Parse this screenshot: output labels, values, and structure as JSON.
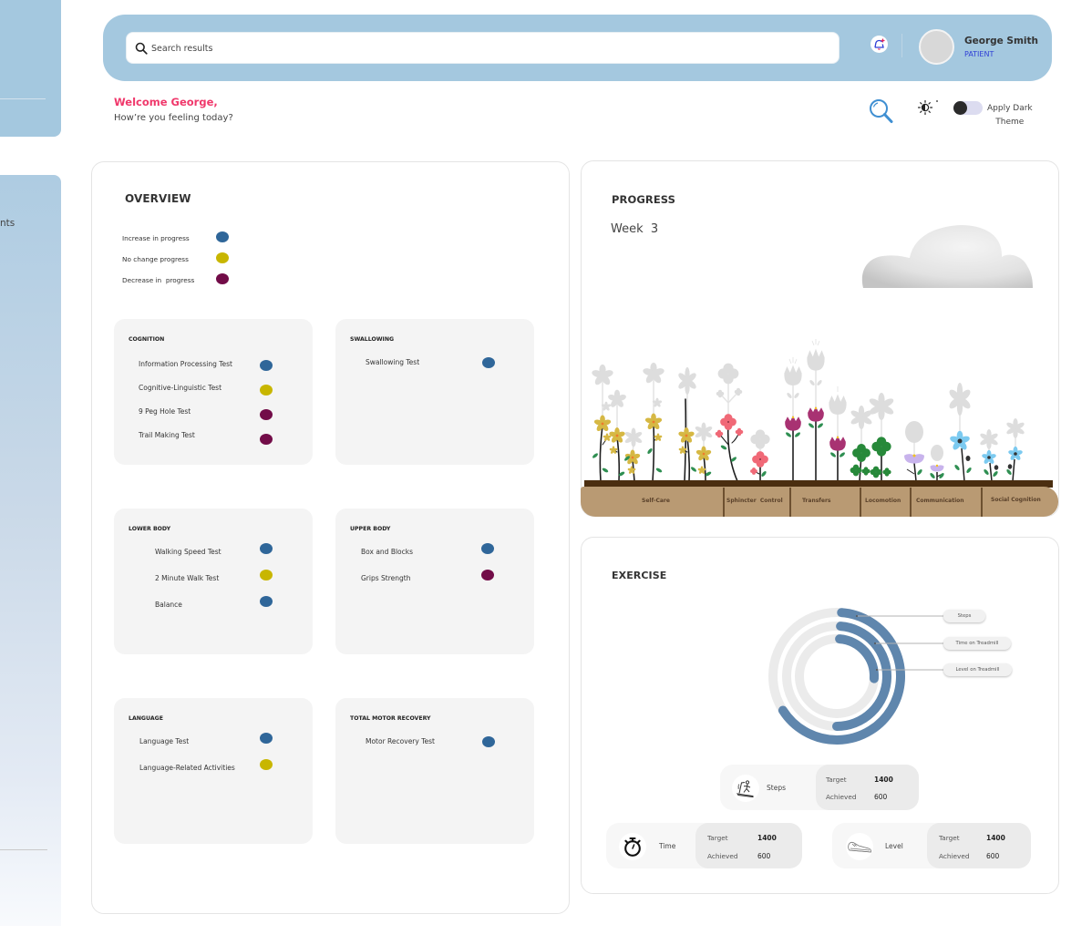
{
  "sidebar": {
    "nav_items": [
      {
        "label": "nts"
      }
    ]
  },
  "header": {
    "search": {
      "placeholder": "Search results",
      "value": ""
    },
    "notification_icon": "bell-plus-icon",
    "user": {
      "name": "George Smith",
      "role": "PATIENT"
    }
  },
  "greeting": {
    "title": "Welcome George,",
    "subtitle": "How’re you feeling today?"
  },
  "toolbar": {
    "search_icon": "magnifier-icon",
    "brightness_icon": "brightness-icon",
    "dark_theme": {
      "label_line1": "Apply Dark",
      "label_line2": "Theme",
      "enabled": false
    }
  },
  "status_colors": {
    "increase": "#2f6699",
    "no_change": "#c8b600",
    "decrease": "#720c48"
  },
  "overview": {
    "title": "OVERVIEW",
    "legend": [
      {
        "label": "Increase in progress",
        "status": "increase"
      },
      {
        "label": "No change progress",
        "status": "no_change"
      },
      {
        "label": "Decrease in  progress",
        "status": "decrease"
      }
    ],
    "categories": [
      {
        "title": "COGNITION",
        "tests": [
          {
            "name": "Information Processing Test",
            "status": "increase"
          },
          {
            "name": "Cognitive-Linguistic Test",
            "status": "no_change"
          },
          {
            "name": "9 Peg Hole Test",
            "status": "decrease"
          },
          {
            "name": "Trail Making Test",
            "status": "decrease"
          }
        ]
      },
      {
        "title": "SWALLOWING",
        "tests": [
          {
            "name": "Swallowing Test",
            "status": "increase"
          }
        ]
      },
      {
        "title": "LOWER BODY",
        "tests": [
          {
            "name": "Walking Speed Test",
            "status": "increase"
          },
          {
            "name": "2 Minute Walk Test",
            "status": "no_change"
          },
          {
            "name": "Balance",
            "status": "increase"
          }
        ]
      },
      {
        "title": "UPPER BODY",
        "tests": [
          {
            "name": "Box and Blocks",
            "status": "increase"
          },
          {
            "name": "Grips Strength",
            "status": "decrease"
          }
        ]
      },
      {
        "title": "LANGUAGE",
        "tests": [
          {
            "name": "Language Test",
            "status": "increase"
          },
          {
            "name": "Language-Related Activities",
            "status": "no_change"
          }
        ]
      },
      {
        "title": "TOTAL MOTOR RECOVERY",
        "tests": [
          {
            "name": "Motor Recovery Test",
            "status": "increase"
          }
        ]
      }
    ]
  },
  "progress": {
    "title": "PROGRESS",
    "week_label": "Week  3",
    "domains": [
      "Self-Care",
      "Sphincter  Control",
      "Transfers",
      "Locomotion",
      "Communication",
      "Social Cognition"
    ]
  },
  "exercise": {
    "title": "EXERCISE",
    "stats": [
      {
        "label": "Steps",
        "icon": "treadmill-icon",
        "target_label": "Target",
        "target": "1400",
        "achieved_label": "Achieved",
        "achieved": "600"
      },
      {
        "label": "Time",
        "icon": "stopwatch-icon",
        "target_label": "Target",
        "target": "1400",
        "achieved_label": "Achieved",
        "achieved": "600"
      },
      {
        "label": "Level",
        "icon": "shoe-icon",
        "target_label": "Target",
        "target": "1400",
        "achieved_label": "Achieved",
        "achieved": "600"
      }
    ]
  },
  "chart_data": {
    "type": "bar",
    "variant": "radial",
    "title": "",
    "categories": [
      "Steps",
      "Time on Treadmill",
      "Level on Treadmill"
    ],
    "values": [
      0.66,
      0.5,
      0.26
    ],
    "value_unit": "fraction of full circle",
    "colors": {
      "fill": "#5f86ad",
      "track": "#ebebeb"
    },
    "legend": "callouts-right"
  }
}
